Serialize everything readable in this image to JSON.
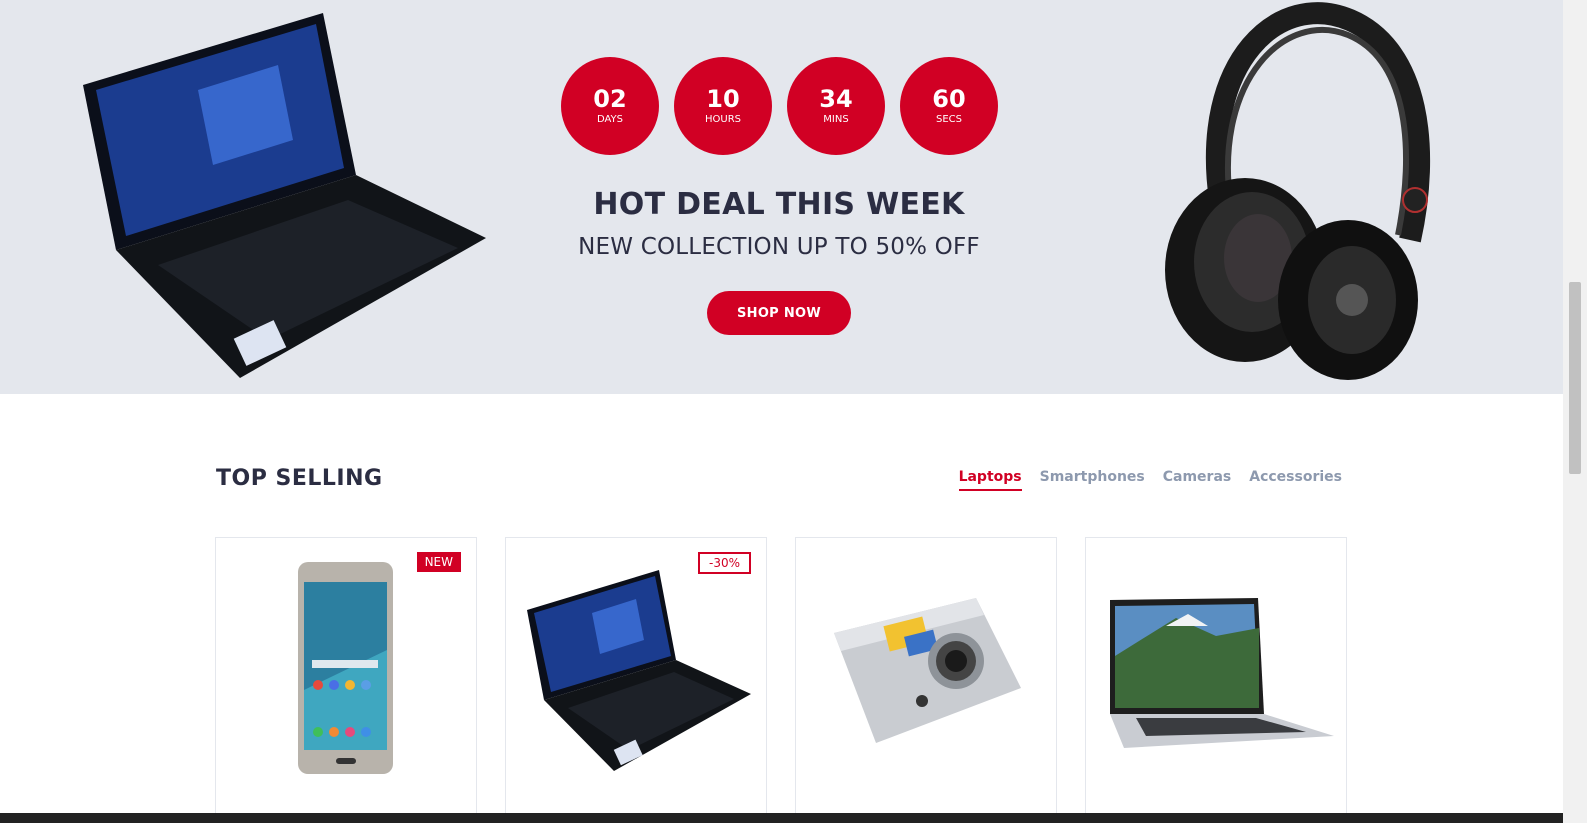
{
  "deal": {
    "countdown": [
      {
        "value": "02",
        "unit": "DAYS"
      },
      {
        "value": "10",
        "unit": "HOURS"
      },
      {
        "value": "34",
        "unit": "MINS"
      },
      {
        "value": "60",
        "unit": "SECS"
      }
    ],
    "title": "HOT DEAL THIS WEEK",
    "subtitle": "NEW COLLECTION UP TO 50% OFF",
    "cta_label": "SHOP NOW"
  },
  "top_selling": {
    "title": "TOP SELLING",
    "tabs": [
      {
        "label": "Laptops",
        "active": true
      },
      {
        "label": "Smartphones",
        "active": false
      },
      {
        "label": "Cameras",
        "active": false
      },
      {
        "label": "Accessories",
        "active": false
      }
    ],
    "products": [
      {
        "image": "smartphone",
        "badge": "NEW",
        "badge_type": "new"
      },
      {
        "image": "laptop",
        "badge": "-30%",
        "badge_type": "sale"
      },
      {
        "image": "camera",
        "badge": "",
        "badge_type": ""
      },
      {
        "image": "macbook",
        "badge": "",
        "badge_type": ""
      }
    ]
  },
  "colors": {
    "accent": "#d10024",
    "banner_bg": "#e4e7ed",
    "heading": "#2b2d42",
    "muted": "#8d99ae"
  }
}
